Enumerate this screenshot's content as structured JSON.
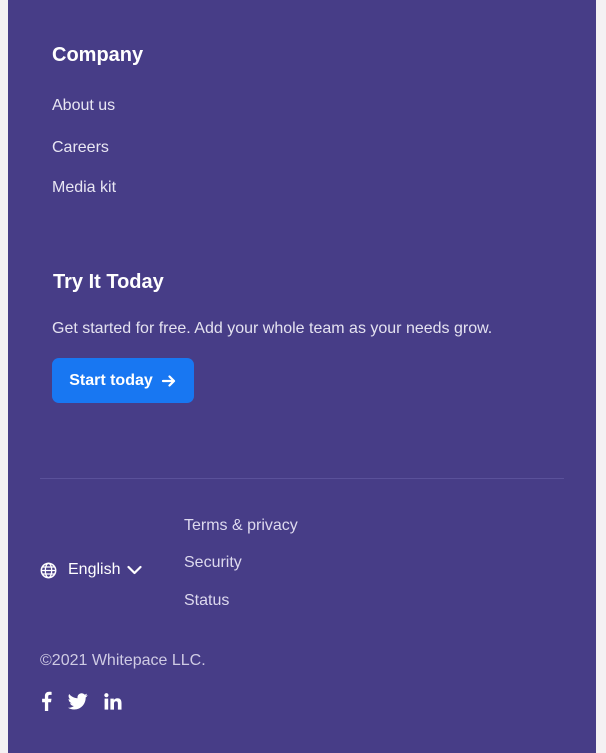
{
  "company": {
    "title": "Company",
    "links": [
      {
        "label": "About us"
      },
      {
        "label": "Careers"
      },
      {
        "label": "Media kit"
      }
    ]
  },
  "try_it": {
    "title": "Try It Today",
    "text": "Get started for free. Add your whole team as your needs grow.",
    "button_label": "Start today",
    "button_icon": "arrow-right-icon"
  },
  "bottom": {
    "language": {
      "label": "English",
      "icon": "globe-icon",
      "dropdown_icon": "chevron-down-icon"
    },
    "links": [
      {
        "label": "Terms & privacy"
      },
      {
        "label": "Security"
      },
      {
        "label": "Status"
      }
    ],
    "copyright": "©2021 Whitepace LLC.",
    "social": [
      {
        "icon": "facebook-icon"
      },
      {
        "icon": "twitter-icon"
      },
      {
        "icon": "linkedin-icon"
      }
    ]
  },
  "colors": {
    "background": "#473d87",
    "button": "#1877f2",
    "page_edge": "#f4f1f3"
  }
}
